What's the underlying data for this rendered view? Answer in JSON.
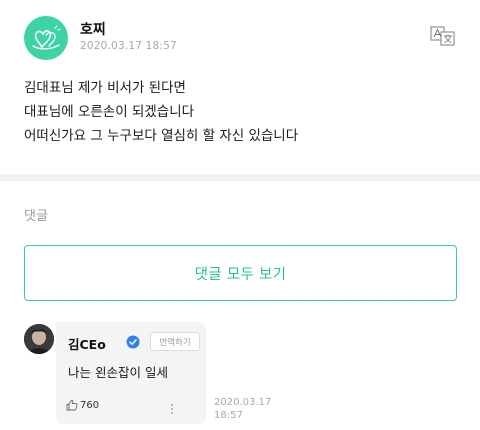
{
  "post": {
    "author": "호찌",
    "date": "2020.03.17 18:57",
    "lines": [
      "김대표님 제가 비서가 된다면",
      "대표님에 오른손이 되겠습니다",
      "어떠신가요 그 누구보다 열심히 할 자신 있습니다"
    ]
  },
  "comments": {
    "section_label": "댓글",
    "view_all_label": "댓글 모두 보기",
    "items": [
      {
        "author": "김CEo",
        "translate_label": "번역하기",
        "text": "나는 왼손잡이 일세",
        "likes": "760",
        "date_line1": "2020.03.17",
        "date_line2": "18:57"
      }
    ]
  },
  "colors": {
    "accent": "#35d0a0",
    "avatar_bg": "#3dd3a4",
    "verified": "#2f80ed"
  },
  "icons": {
    "translate": "translate-icon",
    "verified": "verified-icon",
    "like": "thumbs-up-icon",
    "more": "more-icon"
  }
}
